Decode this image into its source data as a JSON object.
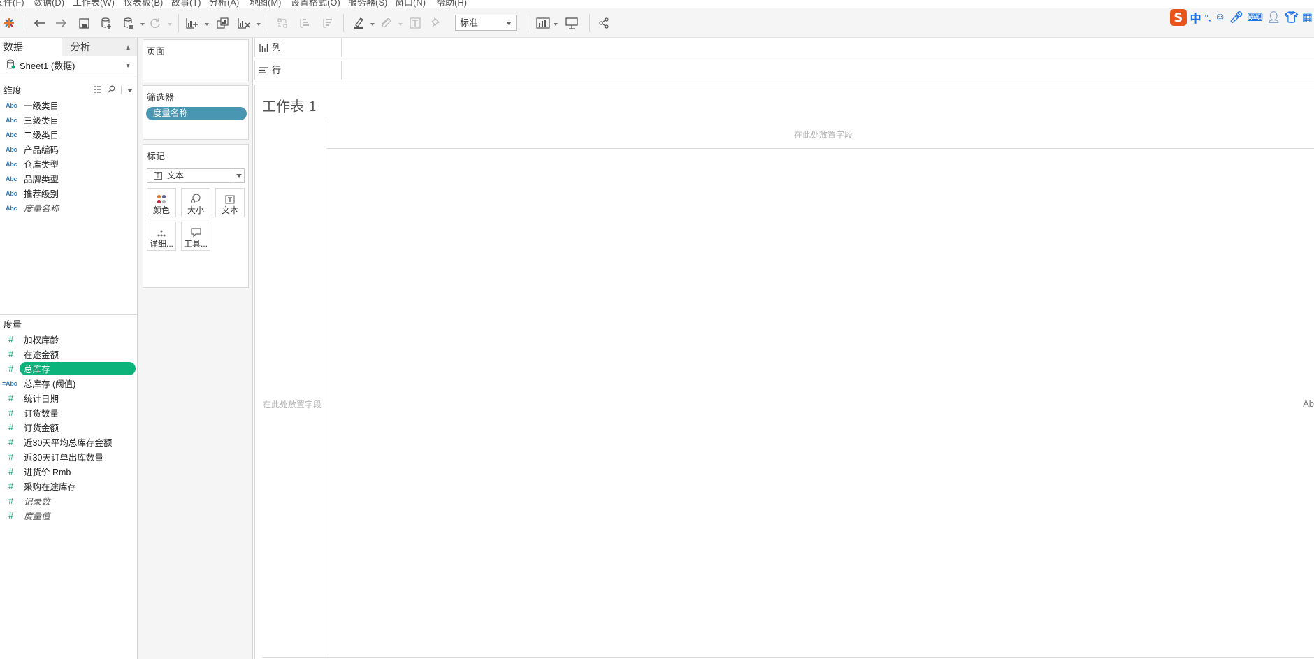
{
  "menu": [
    "文件(F)",
    "数据(D)",
    "工作表(W)",
    "仪表板(B)",
    "故事(T)",
    "分析(A)",
    "地图(M)",
    "设置格式(O)",
    "服务器(S)",
    "窗口(N)",
    "帮助(H)"
  ],
  "toolbar": {
    "fit_value": "标准"
  },
  "ime": {
    "logo": "S",
    "lang": "中",
    "punct": "°,"
  },
  "left_pane": {
    "tabs": {
      "data": "数据",
      "analysis": "分析"
    },
    "datasource": "Sheet1 (数据)",
    "dimensions_title": "维度",
    "dimension_type_icon": "Abc",
    "dimensions": [
      "一级类目",
      "三级类目",
      "二级类目",
      "产品编码",
      "仓库类型",
      "品牌类型",
      "推荐级别",
      "度量名称"
    ],
    "measures_title": "度量",
    "measure_type_icon": "#",
    "measures": [
      "加权库龄",
      "在途金额",
      "总库存",
      "总库存 (阈值)",
      "统计日期",
      "订货数量",
      "订货金额",
      "近30天平均总库存金额",
      "近30天订单出库数量",
      "进货价 Rmb",
      "采购在途库存",
      "记录数",
      "度量值"
    ]
  },
  "cards": {
    "pages_title": "页面",
    "filters_title": "筛选器",
    "filter_pill": "度量名称",
    "marks_title": "标记",
    "mark_type": "文本",
    "mark_buttons": {
      "color": "颜色",
      "size": "大小",
      "text": "文本",
      "detail": "详细...",
      "tooltip": "工具..."
    }
  },
  "shelves": {
    "columns": "列",
    "rows": "行"
  },
  "sheet": {
    "title": "工作表 1",
    "drop_top": "在此处放置字段",
    "drop_left": "在此处放置字段",
    "edge_text": "Ab"
  }
}
